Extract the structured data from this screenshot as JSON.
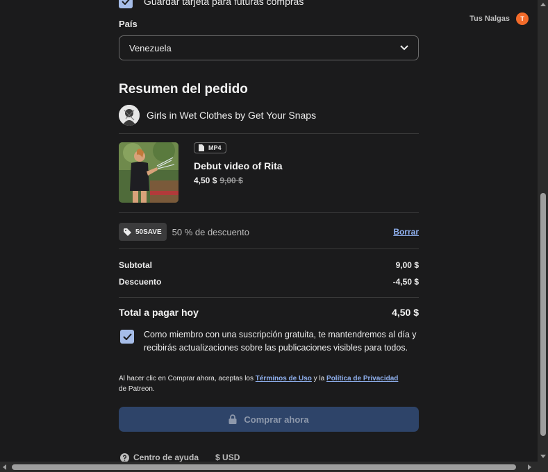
{
  "header": {
    "save_card_label": "Guardar tarjeta para futuras compras",
    "user_name": "Tus Nalgas",
    "user_initial": "T"
  },
  "country": {
    "label": "País",
    "value": "Venezuela"
  },
  "summary": {
    "title": "Resumen del pedido",
    "creator": "Girls in Wet Clothes by Get Your Snaps",
    "product": {
      "format": "MP4",
      "title": "Debut video of Rita",
      "price": "4,50 $",
      "old_price": "9,00 $"
    },
    "coupon": {
      "code": "50SAVE",
      "description": "50 % de descuento",
      "remove_label": "Borrar"
    },
    "subtotal_label": "Subtotal",
    "subtotal_value": "9,00 $",
    "discount_label": "Descuento",
    "discount_value": "-4,50 $",
    "total_label": "Total a pagar hoy",
    "total_value": "4,50 $"
  },
  "membership_text": "Como miembro con una suscripción gratuita, te mantendremos al día y recibirás actualizaciones sobre las publicaciones visibles para todos.",
  "legal": {
    "prefix": "Al hacer clic en Comprar ahora, aceptas los ",
    "terms": "Términos de Uso",
    "middle": " y la ",
    "privacy": "Política de Privacidad",
    "suffix": " de Patreon."
  },
  "buy_button_label": "Comprar ahora",
  "footer": {
    "help": "Centro de ayuda",
    "currency": "$ USD"
  },
  "colors": {
    "background": "#1b1b1c",
    "accent_link": "#8fb0ee",
    "checkbox": "#a6bde8",
    "button_disabled": "#2e4469",
    "avatar": "#f36b2a"
  }
}
